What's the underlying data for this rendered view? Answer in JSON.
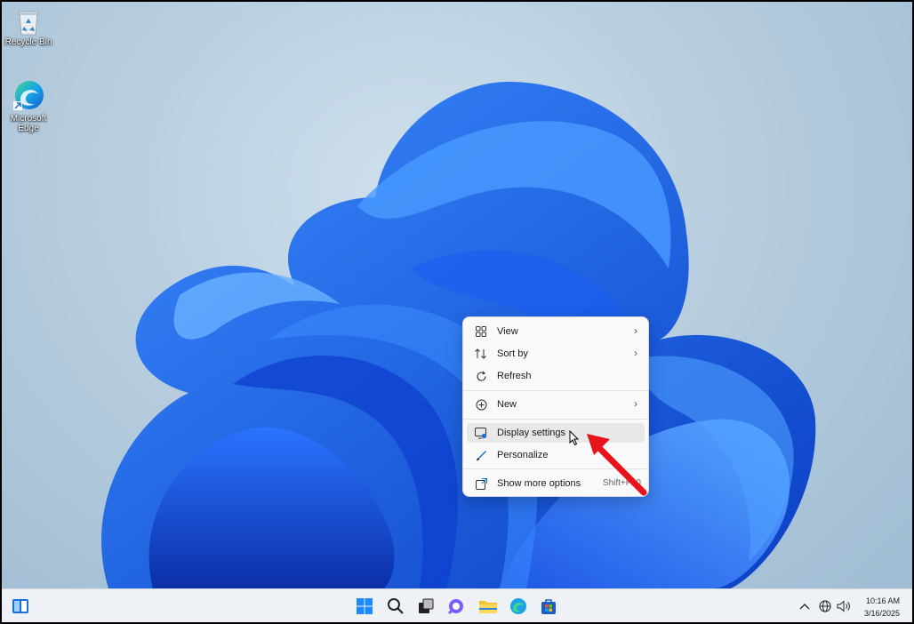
{
  "desktop": {
    "icons": [
      {
        "label": "Recycle Bin",
        "icon": "recycle-bin-icon"
      },
      {
        "label": "Microsoft Edge",
        "icon": "edge-icon"
      }
    ]
  },
  "context_menu": {
    "items": [
      {
        "label": "View",
        "icon": "grid-view-icon",
        "submenu": true
      },
      {
        "label": "Sort by",
        "icon": "sort-icon",
        "submenu": true
      },
      {
        "label": "Refresh",
        "icon": "refresh-icon",
        "submenu": false
      },
      {
        "label": "New",
        "icon": "plus-circle-icon",
        "submenu": true
      },
      {
        "label": "Display settings",
        "icon": "display-icon",
        "submenu": false,
        "highlighted": true
      },
      {
        "label": "Personalize",
        "icon": "brush-icon",
        "submenu": false
      },
      {
        "label": "Show more options",
        "icon": "more-options-icon",
        "shortcut": "Shift+F10"
      }
    ],
    "chevron": "›"
  },
  "taskbar": {
    "icons": [
      "widgets-icon",
      "start-icon",
      "search-icon",
      "task-view-icon",
      "chat-icon",
      "file-explorer-icon",
      "edge-icon",
      "store-icon"
    ],
    "tray": {
      "time": "10:16 AM",
      "date": "3/16/2025",
      "icons": [
        "chevron-up-icon",
        "network-icon",
        "volume-icon"
      ]
    }
  },
  "annotation": {
    "type": "red-arrow",
    "color": "#e8141c"
  }
}
